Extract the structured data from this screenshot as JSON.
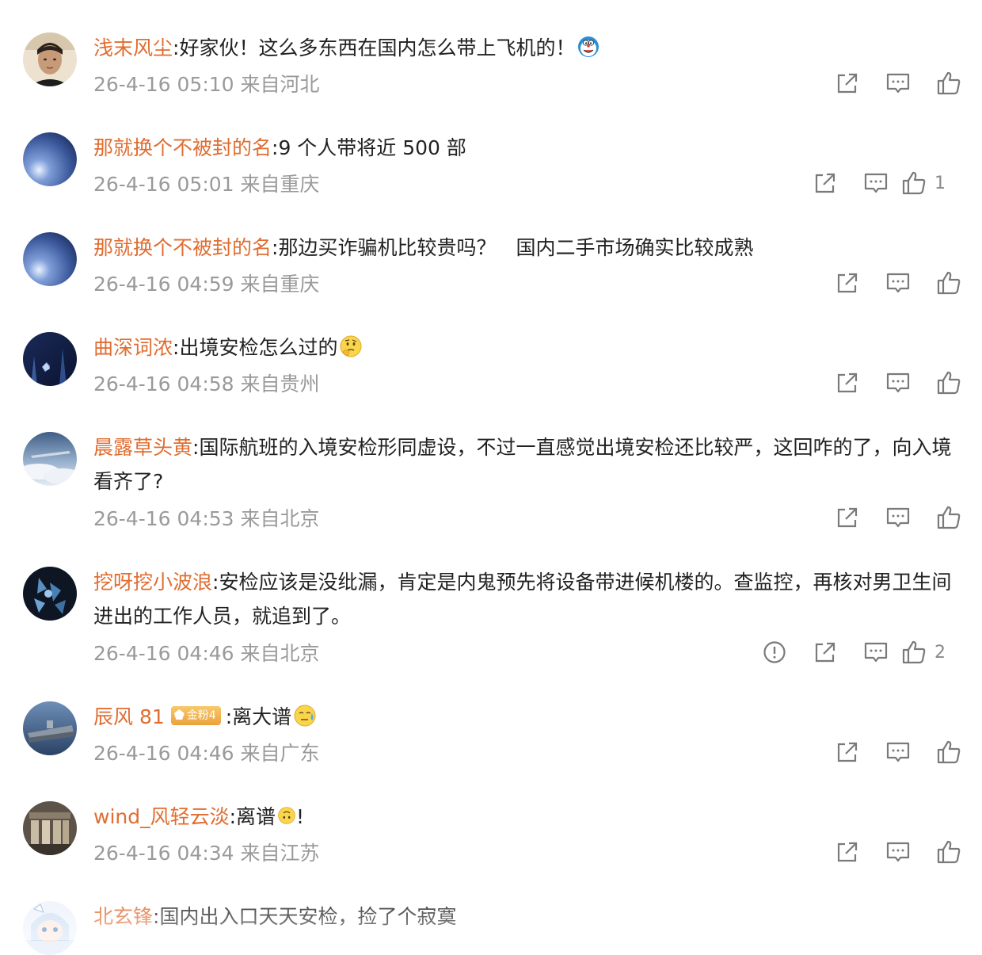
{
  "comments": [
    {
      "username": "浅末风尘",
      "text": ":好家伙！这么多东西在国内怎么带上飞机的！",
      "emoji": "doraemon-emoji",
      "meta": "26-4-16 05:10 来自河北",
      "likes": "",
      "avatar": "man-photo-avatar"
    },
    {
      "username": "那就换个不被封的名",
      "text": ":9 个人带将近 500 部",
      "meta": "26-4-16 05:01 来自重庆",
      "likes": "1",
      "avatar": "blue-sphere-avatar"
    },
    {
      "username": "那就换个不被封的名",
      "text": ":那边买诈骗机比较贵吗？　国内二手市场确实比较成熟",
      "meta": "26-4-16 04:59 来自重庆",
      "likes": "",
      "avatar": "blue-sphere-avatar"
    },
    {
      "username": "曲深词浓",
      "text": ":出境安检怎么过的",
      "emoji": "thinking-face-emoji",
      "meta": "26-4-16 04:58 来自贵州",
      "likes": "",
      "avatar": "dark-blue-night-avatar"
    },
    {
      "username": "晨露草头黄",
      "text": ":国际航班的入境安检形同虚设，不过一直感觉出境安检还比较严，这回咋的了，向入境看齐了?",
      "meta": "26-4-16 04:53 来自北京",
      "likes": "",
      "avatar": "sky-airplane-avatar"
    },
    {
      "username": "挖呀挖小波浪",
      "text": ":安检应该是没纰漏，肯定是内鬼预先将设备带进候机楼的。查监控，再核对男卫生间进出的工作人员，就追到了。",
      "meta": "26-4-16 04:46 来自北京",
      "likes": "2",
      "avatar": "dark-crystal-avatar",
      "has_report": true
    },
    {
      "username": "辰风 81",
      "badge": "金粉4",
      "text": ":离大谱",
      "emoji": "sweat-face-emoji",
      "meta": "26-4-16 04:46 来自广东",
      "likes": "",
      "avatar": "warship-avatar"
    },
    {
      "username": "wind_风轻云淡",
      "text": ":离谱",
      "emoji": "upside-down-face-emoji",
      "text_after": "!",
      "meta": "26-4-16 04:34 来自江苏",
      "likes": "",
      "avatar": "old-building-avatar"
    },
    {
      "username": "北玄锋",
      "text": ":国内出入口天天安检，捡了个寂寞",
      "meta": "",
      "likes": "",
      "avatar": "anime-girl-avatar"
    }
  ],
  "icons": {
    "share": "share-icon",
    "comment": "comment-icon",
    "like": "thumbs-up-icon",
    "report": "report-icon"
  },
  "colors": {
    "username": "#e06d31",
    "meta": "#9a9a9a",
    "icon": "#7a7a7a",
    "text": "#222222"
  }
}
